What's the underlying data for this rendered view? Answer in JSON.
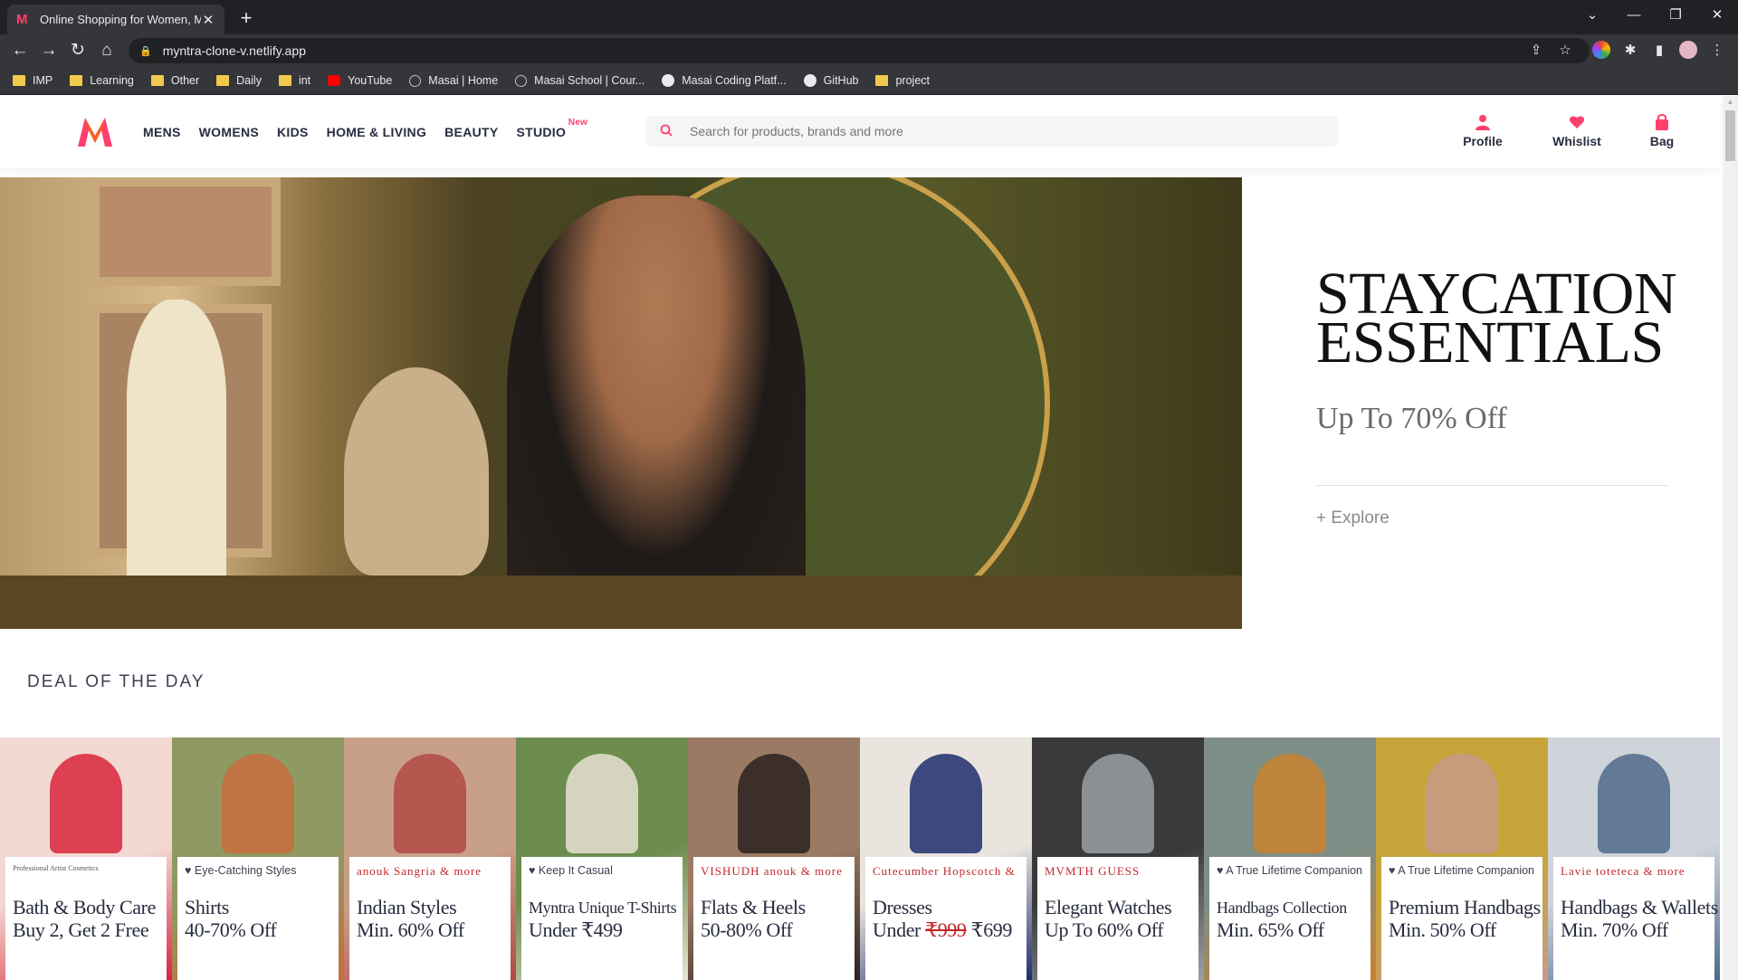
{
  "browser": {
    "tab_title": "Online Shopping for Women, Me",
    "url": "myntra-clone-v.netlify.app",
    "bookmarks": [
      {
        "label": "IMP",
        "icon": "folder"
      },
      {
        "label": "Learning",
        "icon": "folder"
      },
      {
        "label": "Other",
        "icon": "folder"
      },
      {
        "label": "Daily",
        "icon": "folder"
      },
      {
        "label": "int",
        "icon": "folder"
      },
      {
        "label": "YouTube",
        "icon": "youtube"
      },
      {
        "label": "Masai | Home",
        "icon": "masai"
      },
      {
        "label": "Masai School | Cour...",
        "icon": "globe"
      },
      {
        "label": "Masai Coding Platf...",
        "icon": "masai-circle"
      },
      {
        "label": "GitHub",
        "icon": "github"
      },
      {
        "label": "project",
        "icon": "folder"
      }
    ]
  },
  "header": {
    "nav": [
      "MENS",
      "WOMENS",
      "KIDS",
      "HOME & LIVING",
      "BEAUTY",
      "STUDIO"
    ],
    "studio_badge": "New",
    "search_placeholder": "Search for products, brands and more",
    "actions": {
      "profile": "Profile",
      "wishlist": "Whislist",
      "bag": "Bag"
    },
    "brand_color": "#ff3f6c"
  },
  "hero": {
    "title_line1": "STAYCATION",
    "title_line2": "ESSENTIALS",
    "subtitle": "Up To 70% Off",
    "link": "+ Explore",
    "slides_total": 5,
    "active_slide": 1
  },
  "deal": {
    "title": "DEAL OF THE DAY",
    "cards": [
      {
        "tag": "",
        "brand": "Professional Artist Cosmetics",
        "line1": "Bath & Body Care",
        "line2": "Buy 2, Get 2 Free",
        "bg": "#f2d9d2",
        "accent": "#d9243b"
      },
      {
        "tag": "Eye-Catching Styles",
        "brand": "",
        "line1": "Shirts",
        "line2": "40-70% Off",
        "bg": "#8f9a62",
        "accent": "#c96c3e"
      },
      {
        "tag": "",
        "brand": "anouk  Sangria  & more",
        "line1": "Indian Styles",
        "line2": "Min. 60% Off",
        "bg": "#c8a089",
        "accent": "#b24a44"
      },
      {
        "tag": "Keep It Casual",
        "brand": "",
        "line1": "Myntra Unique T-Shirts",
        "line2": "Under ₹499",
        "bg": "#6d8d4f",
        "accent": "#e8e2d2"
      },
      {
        "tag": "",
        "brand": "VISHUDH  anouk  & more",
        "line1": "Flats & Heels",
        "line2": "50-80% Off",
        "bg": "#9a7a62",
        "accent": "#2b2220"
      },
      {
        "tag": "",
        "brand": "Cutecumber  Hopscotch  & more",
        "line1": "Dresses",
        "line2_pre": "Under ",
        "line2_strike": "₹999",
        "line2_post": " ₹699",
        "bg": "#e9e4de",
        "accent": "#1f2d6e"
      },
      {
        "tag": "",
        "brand": "MVMTH  GUESS",
        "line1": "Elegant Watches",
        "line2": "Up To 60% Off",
        "bg": "#3a3a3a",
        "accent": "#9aa0a6"
      },
      {
        "tag": "A True Lifetime Companion",
        "brand": "",
        "line1": "Handbags Collection",
        "line2": "Min. 65% Off",
        "bg": "#7d8e86",
        "accent": "#c9822f"
      },
      {
        "tag": "A True Lifetime Companion",
        "brand": "",
        "line1": "Premium Handbags",
        "line2": "Min. 50% Off",
        "bg": "#c6a43a",
        "accent": "#c79b88"
      },
      {
        "tag": "",
        "brand": "Lavie  toteteca  & more",
        "line1": "Handbags & Wallets",
        "line2": "Min. 70% Off",
        "bg": "#cfd3da",
        "accent": "#4f6a8a"
      }
    ]
  }
}
